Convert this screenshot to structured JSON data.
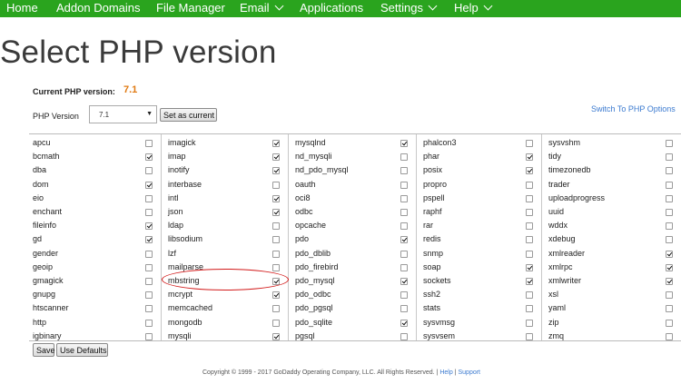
{
  "nav": {
    "items": [
      {
        "label": "Home",
        "has_menu": false
      },
      {
        "label": "Addon Domains",
        "has_menu": false
      },
      {
        "label": "File Manager",
        "has_menu": false
      },
      {
        "label": "Email",
        "has_menu": true
      },
      {
        "label": "Applications",
        "has_menu": false
      },
      {
        "label": "Settings",
        "has_menu": true
      },
      {
        "label": "Help",
        "has_menu": true
      }
    ],
    "color": "#2aa41e"
  },
  "page": {
    "title": "Select PHP version",
    "current_label": "Current PHP version:",
    "current_value": "7.1",
    "php_version_label": "PHP Version",
    "php_version_selected": "7.1",
    "set_current_label": "Set as current",
    "switch_link": "Switch To PHP Options",
    "accent_color": "#e07a12"
  },
  "extensions": [
    [
      {
        "name": "apcu",
        "checked": false
      },
      {
        "name": "bcmath",
        "checked": true
      },
      {
        "name": "dba",
        "checked": false
      },
      {
        "name": "dom",
        "checked": true
      },
      {
        "name": "eio",
        "checked": false
      },
      {
        "name": "enchant",
        "checked": false
      },
      {
        "name": "fileinfo",
        "checked": true
      },
      {
        "name": "gd",
        "checked": true
      },
      {
        "name": "gender",
        "checked": false
      },
      {
        "name": "geoip",
        "checked": false
      },
      {
        "name": "gmagick",
        "checked": false
      },
      {
        "name": "gnupg",
        "checked": false
      },
      {
        "name": "htscanner",
        "checked": false
      },
      {
        "name": "http",
        "checked": false
      },
      {
        "name": "igbinary",
        "checked": false
      }
    ],
    [
      {
        "name": "imagick",
        "checked": true
      },
      {
        "name": "imap",
        "checked": true
      },
      {
        "name": "inotify",
        "checked": true
      },
      {
        "name": "interbase",
        "checked": false
      },
      {
        "name": "intl",
        "checked": true
      },
      {
        "name": "json",
        "checked": true
      },
      {
        "name": "ldap",
        "checked": false
      },
      {
        "name": "libsodium",
        "checked": false
      },
      {
        "name": "lzf",
        "checked": false
      },
      {
        "name": "mailparse",
        "checked": false
      },
      {
        "name": "mbstring",
        "checked": true
      },
      {
        "name": "mcrypt",
        "checked": true
      },
      {
        "name": "memcached",
        "checked": false
      },
      {
        "name": "mongodb",
        "checked": false
      },
      {
        "name": "mysqli",
        "checked": true
      }
    ],
    [
      {
        "name": "mysqlnd",
        "checked": true
      },
      {
        "name": "nd_mysqli",
        "checked": false
      },
      {
        "name": "nd_pdo_mysql",
        "checked": false
      },
      {
        "name": "oauth",
        "checked": false
      },
      {
        "name": "oci8",
        "checked": false
      },
      {
        "name": "odbc",
        "checked": false
      },
      {
        "name": "opcache",
        "checked": false
      },
      {
        "name": "pdo",
        "checked": true
      },
      {
        "name": "pdo_dblib",
        "checked": false
      },
      {
        "name": "pdo_firebird",
        "checked": false
      },
      {
        "name": "pdo_mysql",
        "checked": true
      },
      {
        "name": "pdo_odbc",
        "checked": false
      },
      {
        "name": "pdo_pgsql",
        "checked": false
      },
      {
        "name": "pdo_sqlite",
        "checked": true
      },
      {
        "name": "pgsql",
        "checked": false
      }
    ],
    [
      {
        "name": "phalcon3",
        "checked": false
      },
      {
        "name": "phar",
        "checked": true
      },
      {
        "name": "posix",
        "checked": true
      },
      {
        "name": "propro",
        "checked": false
      },
      {
        "name": "pspell",
        "checked": false
      },
      {
        "name": "raphf",
        "checked": false
      },
      {
        "name": "rar",
        "checked": false
      },
      {
        "name": "redis",
        "checked": false
      },
      {
        "name": "snmp",
        "checked": false
      },
      {
        "name": "soap",
        "checked": true
      },
      {
        "name": "sockets",
        "checked": true
      },
      {
        "name": "ssh2",
        "checked": false
      },
      {
        "name": "stats",
        "checked": false
      },
      {
        "name": "sysvmsg",
        "checked": false
      },
      {
        "name": "sysvsem",
        "checked": false
      }
    ],
    [
      {
        "name": "sysvshm",
        "checked": false
      },
      {
        "name": "tidy",
        "checked": false
      },
      {
        "name": "timezonedb",
        "checked": false
      },
      {
        "name": "trader",
        "checked": false
      },
      {
        "name": "uploadprogress",
        "checked": false
      },
      {
        "name": "uuid",
        "checked": false
      },
      {
        "name": "wddx",
        "checked": false
      },
      {
        "name": "xdebug",
        "checked": false
      },
      {
        "name": "xmlreader",
        "checked": true
      },
      {
        "name": "xmlrpc",
        "checked": true
      },
      {
        "name": "xmlwriter",
        "checked": true
      },
      {
        "name": "xsl",
        "checked": false
      },
      {
        "name": "yaml",
        "checked": false
      },
      {
        "name": "zip",
        "checked": false
      },
      {
        "name": "zmq",
        "checked": false
      }
    ]
  ],
  "actions": {
    "save_label": "Save",
    "defaults_label": "Use Defaults"
  },
  "footer": {
    "copyright": "Copyright © 1999 - 2017 GoDaddy Operating Company, LLC. All Rights Reserved.",
    "separator": "|",
    "help": "Help",
    "support": "Support"
  },
  "annotation": {
    "color": "#d21a1a"
  }
}
